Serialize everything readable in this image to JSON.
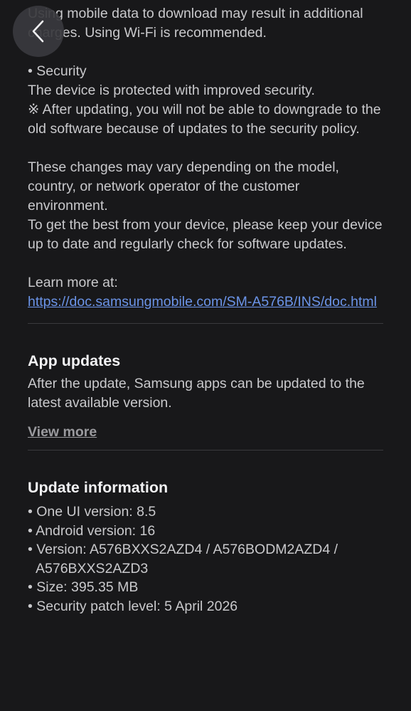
{
  "back_button_icon": "chevron-left-icon",
  "intro": {
    "line1": "Using mobile data to download may result in additional charges. Using Wi-Fi is recommended."
  },
  "security": {
    "title": "• Security",
    "line": "The device is protected with improved security.",
    "note": "※ After updating, you will not be able to downgrade to the old software because of updates to the security policy."
  },
  "disclaimer": {
    "line1": "These changes may vary depending on the model, country, or network operator of the customer environment.",
    "line2": "To get the best from your device, please keep your device up to date and regularly check for software updates."
  },
  "learn_more": {
    "label": "Learn more at:",
    "url": "https://doc.samsungmobile.com/SM-A576B/INS/doc.html"
  },
  "app_updates": {
    "title": "App updates",
    "body": "After the update, Samsung apps can be updated to the latest available version.",
    "view_more": "View more"
  },
  "update_info": {
    "title": "Update information",
    "items": [
      "• One UI version: 8.5",
      "• Android version: 16",
      "• Version: A576BXXS2AZD4 / A576BODM2AZD4 / A576BXXS2AZD3",
      "• Size: 395.35 MB",
      "• Security patch level: 5 April 2026"
    ]
  },
  "colors": {
    "background": "#18181a",
    "text": "#c9c9cc",
    "heading": "#f2f2f4",
    "link": "#6b94e8",
    "divider": "#3a3a3d"
  }
}
